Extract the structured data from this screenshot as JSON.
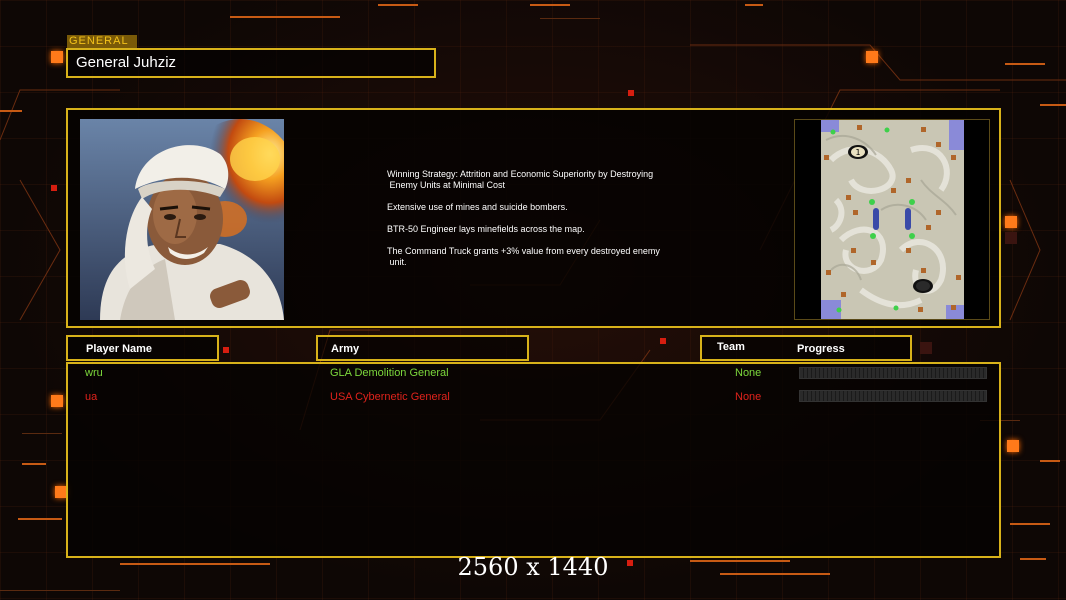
{
  "header": {
    "section_tag": "GENERAL",
    "general_name": "General Juhziz"
  },
  "general": {
    "portrait_icon": "general-portrait",
    "description": [
      "Winning Strategy: Attrition and Economic Superiority by Destroying\n Enemy Units at Minimal Cost",
      "Extensive use of mines and suicide bombers.",
      "BTR-50 Engineer lays minefields across the map.",
      "The Command Truck grants +3% value from every destroyed enemy\n unit."
    ],
    "map_markers": [
      "1"
    ]
  },
  "table": {
    "headers": {
      "player_name": "Player Name",
      "army": "Army",
      "team": "Team",
      "progress": "Progress"
    },
    "rows": [
      {
        "player": "wru",
        "army": "GLA Demolition General",
        "team": "None",
        "progress": 0,
        "color": "#7cd83c"
      },
      {
        "player": "ua",
        "army": "USA Cybernetic General",
        "team": "None",
        "progress": 0,
        "color": "#e0231c"
      }
    ]
  },
  "footer": {
    "resolution_label": "2560 x 1440"
  },
  "colors": {
    "frame": "#d8b21a",
    "accent": "#ff7a1a",
    "player1": "#7cd83c",
    "player2": "#e0231c"
  }
}
